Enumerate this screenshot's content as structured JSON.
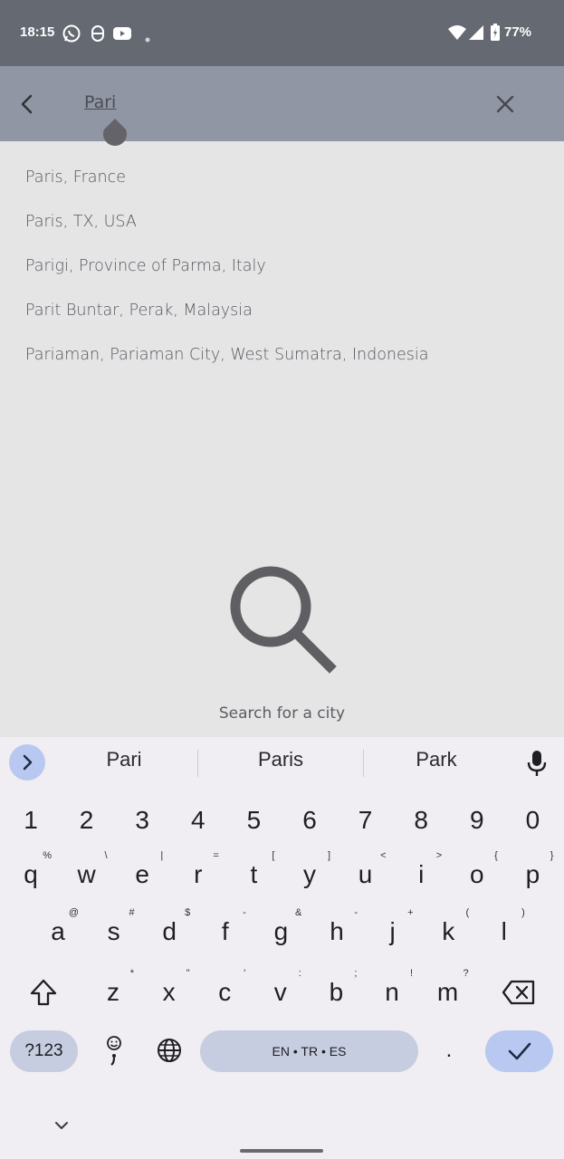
{
  "status_bar": {
    "time": "18:15",
    "battery": "77%",
    "icons": [
      "whatsapp-icon",
      "app-icon",
      "youtube-icon",
      "dot-icon",
      "wifi-icon",
      "signal-icon",
      "battery-icon"
    ]
  },
  "search": {
    "query": "Pari"
  },
  "results": [
    "Paris, France",
    "Paris, TX, USA",
    "Parigi, Province of Parma, Italy",
    "Parit Buntar, Perak, Malaysia",
    "Pariaman, Pariaman City, West Sumatra, Indonesia"
  ],
  "empty_state": {
    "label": "Search for a city"
  },
  "keyboard": {
    "suggestions": [
      "Pari",
      "Paris",
      "Park"
    ],
    "number_row": [
      "1",
      "2",
      "3",
      "4",
      "5",
      "6",
      "7",
      "8",
      "9",
      "0"
    ],
    "row1": [
      {
        "k": "q",
        "h": "%"
      },
      {
        "k": "w",
        "h": "\\"
      },
      {
        "k": "e",
        "h": "|"
      },
      {
        "k": "r",
        "h": "="
      },
      {
        "k": "t",
        "h": "["
      },
      {
        "k": "y",
        "h": "]"
      },
      {
        "k": "u",
        "h": "<"
      },
      {
        "k": "i",
        "h": ">"
      },
      {
        "k": "o",
        "h": "{"
      },
      {
        "k": "p",
        "h": "}"
      }
    ],
    "row2": [
      {
        "k": "a",
        "h": "@"
      },
      {
        "k": "s",
        "h": "#"
      },
      {
        "k": "d",
        "h": "$"
      },
      {
        "k": "f",
        "h": "-"
      },
      {
        "k": "g",
        "h": "&"
      },
      {
        "k": "h",
        "h": "-"
      },
      {
        "k": "j",
        "h": "+"
      },
      {
        "k": "k",
        "h": "("
      },
      {
        "k": "l",
        "h": ")"
      }
    ],
    "row3": [
      {
        "k": "z",
        "h": "*"
      },
      {
        "k": "x",
        "h": "\""
      },
      {
        "k": "c",
        "h": "'"
      },
      {
        "k": "v",
        "h": ":"
      },
      {
        "k": "b",
        "h": ";"
      },
      {
        "k": "n",
        "h": "!"
      },
      {
        "k": "m",
        "h": "?"
      }
    ],
    "symbols_label": "?123",
    "space_label": "EN • TR • ES",
    "period_label": ".",
    "colors": {
      "accent": "#b8c8f0",
      "pill": "#c6cde0",
      "bg": "#f0edf3"
    }
  }
}
